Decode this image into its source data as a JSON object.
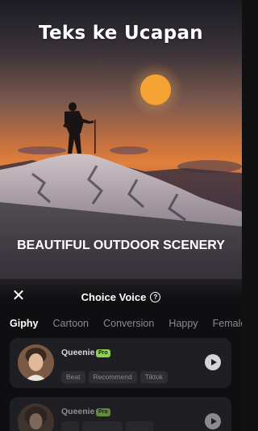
{
  "headline": "Teks ke Ucapan",
  "caption": "BEAUTIFUL OUTDOOR SCENERY",
  "sheet": {
    "title": "Choice Voice",
    "help_symbol": "?",
    "close_symbol": "✕"
  },
  "tabs": [
    {
      "label": "Giphy",
      "active": true
    },
    {
      "label": "Cartoon",
      "active": false
    },
    {
      "label": "Conversion",
      "active": false
    },
    {
      "label": "Happy",
      "active": false
    },
    {
      "label": "Female",
      "active": false
    }
  ],
  "voices": [
    {
      "name": "Queenie",
      "badge": "Pro",
      "tags": [
        "Beat",
        "Recommend",
        "Tiktok"
      ],
      "play_icon": "play-icon"
    },
    {
      "name": "Queenie",
      "badge": "Pro",
      "tags": [
        "",
        "",
        ""
      ],
      "play_icon": "play-icon"
    }
  ],
  "colors": {
    "pro_badge": "#8fd14f",
    "card_bg": "#1f1f23",
    "sun": "#f29a2e"
  }
}
